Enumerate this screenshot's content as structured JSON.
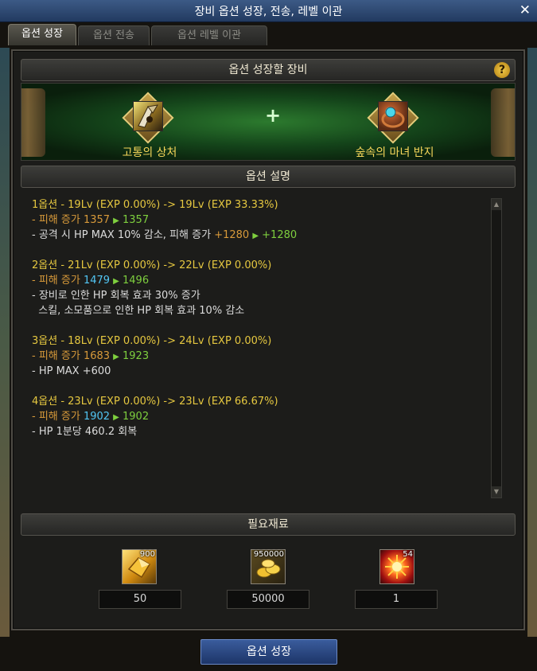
{
  "window": {
    "title": "장비 옵션 성장, 전송, 레벨 이관",
    "close": "✕"
  },
  "tabs": [
    "옵션 성장",
    "옵션 전송",
    "옵션 레벨 이관"
  ],
  "equipment_section": {
    "title": "옵션 성장할 장비",
    "help": "?",
    "plus": "+",
    "items": [
      {
        "name": "고통의 상처",
        "icon": "wound-weapon-icon"
      },
      {
        "name": "숲속의 마녀 반지",
        "icon": "witch-ring-icon"
      }
    ]
  },
  "description_section": {
    "title": "옵션 설명",
    "options": [
      {
        "header": "1옵션 - 19Lv (EXP 0.00%) -> 19Lv (EXP 33.33%)",
        "damage_label": "- 피해 증가 ",
        "damage_before": "1357",
        "arrow": "▶",
        "damage_after": "1357",
        "extra": [
          {
            "prefix": "- 공격 시 HP MAX 10% 감소, 피해 증가 ",
            "before": "+1280",
            "after": "+1280"
          }
        ]
      },
      {
        "header": "2옵션 - 21Lv (EXP 0.00%) -> 22Lv (EXP 0.00%)",
        "damage_label": "- 피해 증가 ",
        "damage_before": "1479",
        "arrow": "▶",
        "damage_after": "1496",
        "lines": [
          "- 장비로 인한 HP 회복 효과 30% 증가",
          "  스킬, 소모품으로 인한 HP 회복 효과 10% 감소"
        ]
      },
      {
        "header": "3옵션 - 18Lv (EXP 0.00%) -> 24Lv (EXP 0.00%)",
        "damage_label": "- 피해 증가 ",
        "damage_before": "1683",
        "arrow": "▶",
        "damage_after": "1923",
        "lines": [
          "- HP MAX +600"
        ]
      },
      {
        "header": "4옵션 - 23Lv (EXP 0.00%) -> 23Lv (EXP 66.67%)",
        "damage_label": "- 피해 증가 ",
        "damage_before": "1902",
        "arrow": "▶",
        "damage_after": "1902",
        "lines": [
          "- HP 1분당 460.2 회복"
        ]
      }
    ]
  },
  "materials_section": {
    "title": "필요재료",
    "items": [
      {
        "icon": "gold-crystal-icon",
        "owned": "900",
        "required": "50"
      },
      {
        "icon": "gold-coins-icon",
        "owned": "950000",
        "required": "50000"
      },
      {
        "icon": "fire-orb-icon",
        "owned": "54",
        "required": "1"
      }
    ]
  },
  "action": {
    "label": "옵션 성장"
  },
  "colors": {
    "header_yellow": "#e6c840",
    "value_green": "#7ecf3e",
    "label_orange": "#d89a3a",
    "value_cyan": "#52c6f4",
    "button_blue": "#2a4a86"
  }
}
